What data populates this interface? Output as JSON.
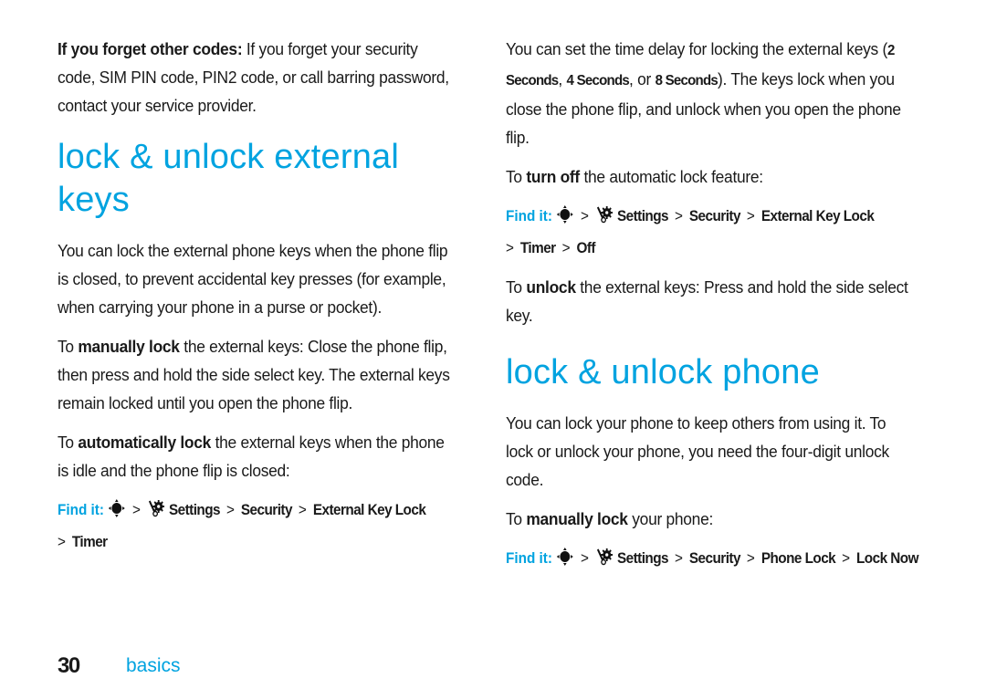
{
  "colors": {
    "accent": "#00a3e0",
    "text": "#1a1a1a"
  },
  "left": {
    "forget_codes": {
      "bold": "If you forget other codes:",
      "text": " If you forget your security code, SIM PIN code, PIN2 code, or call barring password, contact your service provider."
    },
    "heading": "lock & unlock external keys",
    "intro": "You can lock the external phone keys when the phone flip is closed, to prevent accidental key presses (for example, when carrying your phone in a purse or pocket).",
    "manual": {
      "pre": "To ",
      "bold": "manually lock",
      "text": " the external keys: Close the phone flip, then press and hold the side select key. The external keys remain locked until you open the phone flip."
    },
    "auto": {
      "pre": "To ",
      "bold": "automatically lock",
      "text": " the external keys when the phone is idle and the phone flip is closed:"
    },
    "findit": {
      "label": "Find it:",
      "nav_icon": "nav-key-icon",
      "settings_icon": "settings-icon",
      "path": [
        "Settings",
        "Security",
        "External Key Lock",
        "Timer"
      ]
    }
  },
  "right": {
    "delay": {
      "pre": "You can set the time delay for locking the external keys (",
      "opt1": "2 Seconds",
      "opt2": "4 Seconds",
      "or": "or",
      "opt3": "8 Seconds",
      "post": "). The keys lock when you close the phone flip, and unlock when you open the phone flip."
    },
    "turnoff": {
      "pre": "To ",
      "bold": "turn off",
      "text": " the automatic lock feature:"
    },
    "findit_off": {
      "label": "Find it:",
      "path": [
        "Settings",
        "Security",
        "External Key Lock",
        "Timer",
        "Off"
      ]
    },
    "unlock": {
      "pre": "To ",
      "bold": "unlock",
      "text": " the external keys: Press and hold the side select key."
    },
    "heading": "lock & unlock phone",
    "phone_intro": "You can lock your phone to keep others from using it. To lock or unlock your phone, you need the four-digit unlock code.",
    "manual_phone": {
      "pre": "To ",
      "bold": "manually lock",
      "text": " your phone:"
    },
    "findit_phone": {
      "label": "Find it:",
      "path": [
        "Settings",
        "Security",
        "Phone Lock",
        "Lock Now"
      ]
    }
  },
  "footer": {
    "page_number": "30",
    "section": "basics"
  }
}
